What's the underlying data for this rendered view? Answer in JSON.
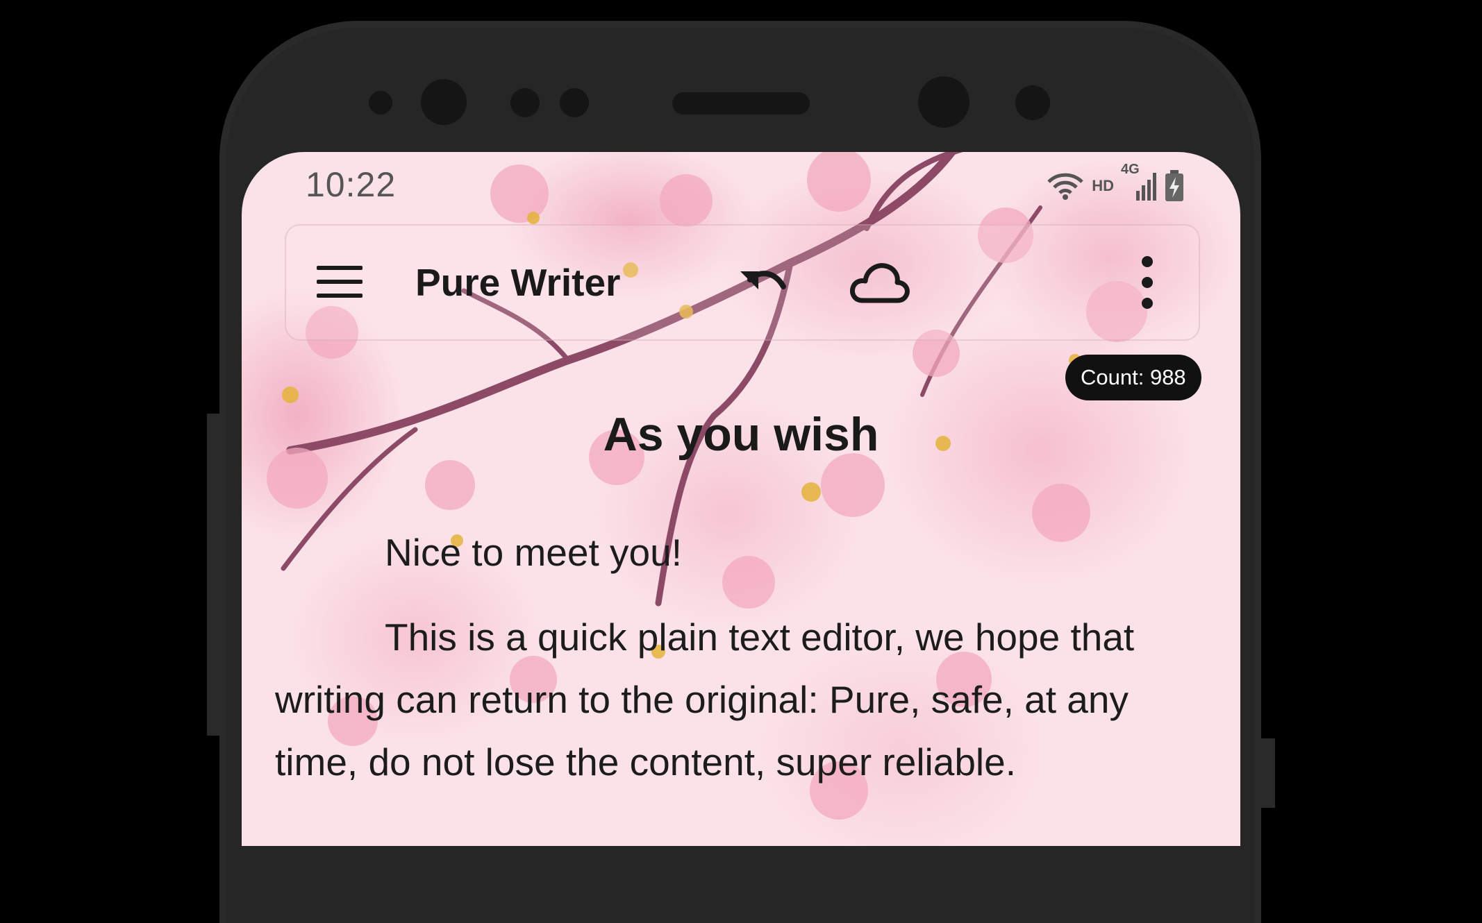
{
  "status_bar": {
    "time": "10:22",
    "network_type": "4G",
    "hd_label": "HD",
    "icons": [
      "wifi-icon",
      "signal-icon",
      "battery-charging-icon"
    ]
  },
  "toolbar": {
    "title": "Pure Writer",
    "icons": [
      "menu-icon",
      "undo-icon",
      "cloud-icon",
      "more-vert-icon"
    ]
  },
  "editor": {
    "count_label": "Count: 988",
    "title": "As you wish",
    "paragraphs": [
      "Nice to meet you!",
      "This is a quick plain text editor, we hope that writing can return to the original: Pure, safe, at any time, do not lose the content, super reliable."
    ]
  },
  "colors": {
    "background": "#fbe2e8",
    "text": "#1a1a1a",
    "badge_bg": "#111111",
    "badge_text": "#ffffff"
  }
}
